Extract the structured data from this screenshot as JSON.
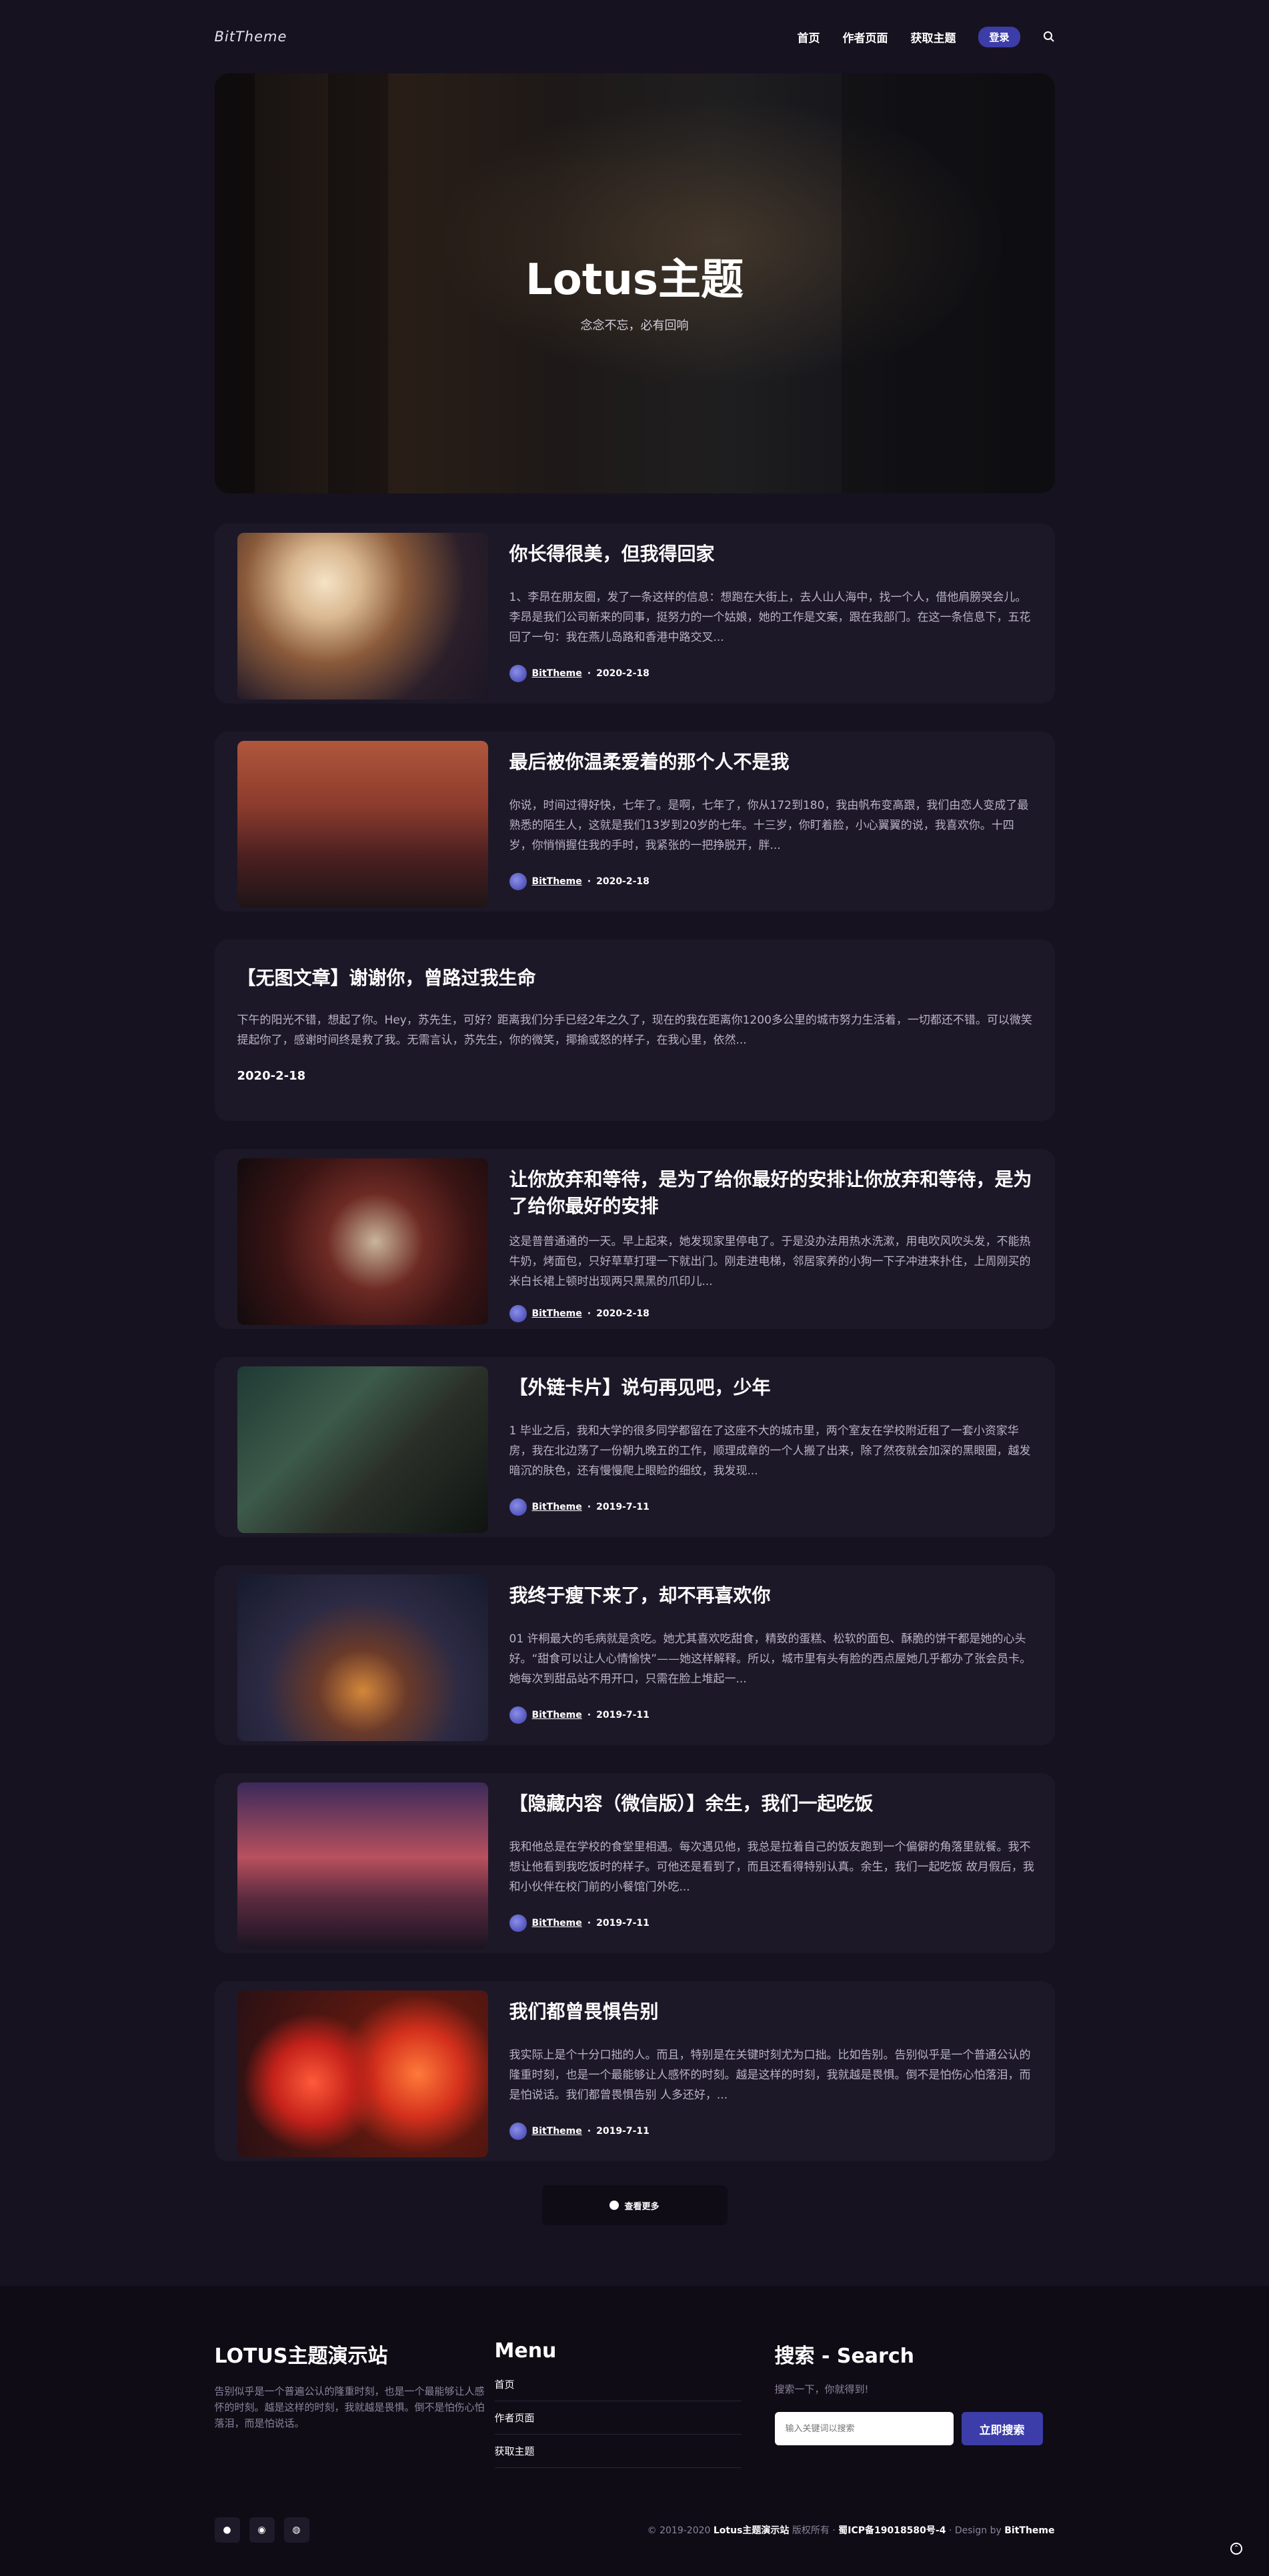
{
  "header": {
    "logo": "BitTheme",
    "nav": [
      "首页",
      "作者页面",
      "获取主题"
    ],
    "login": "登录",
    "search_icon": "search-icon"
  },
  "hero": {
    "title": "Lotus主题",
    "subtitle": "念念不忘，必有回响"
  },
  "posts": [
    {
      "title": "你长得很美，但我得回家",
      "excerpt": "1、李昂在朋友圈，发了一条这样的信息：想跑在大街上，去人山人海中，找一个人，借他肩膀哭会儿。李昂是我们公司新来的同事，挺努力的一个姑娘，她的工作是文案，跟在我部门。在这一条信息下，五花回了一句：我在燕儿岛路和香港中路交叉...",
      "author": "BitTheme",
      "date": "2020-2-18"
    },
    {
      "title": "最后被你温柔爱着的那个人不是我",
      "excerpt": "你说，时间过得好快，七年了。是啊，七年了，你从172到180，我由帆布变高跟，我们由恋人变成了最熟悉的陌生人，这就是我们13岁到20岁的七年。十三岁，你盯着脸，小心翼翼的说，我喜欢你。十四岁，你悄悄握住我的手时，我紧张的一把挣脱开，胖...",
      "author": "BitTheme",
      "date": "2020-2-18"
    },
    {
      "title": "【无图文章】谢谢你，曾路过我生命",
      "excerpt": "下午的阳光不错，想起了你。Hey，苏先生，可好？距离我们分手已经2年之久了，现在的我在距离你1200多公里的城市努力生活着，一切都还不错。可以微笑提起你了，感谢时间终是救了我。无需言认，苏先生，你的微笑，揶揄或怒的样子，在我心里，依然...",
      "date": "2020-2-18"
    },
    {
      "title": "让你放弃和等待，是为了给你最好的安排让你放弃和等待，是为了给你最好的安排",
      "excerpt": "这是普普通通的一天。早上起来，她发现家里停电了。于是没办法用热水洗漱，用电吹风吹头发，不能热牛奶，烤面包，只好草草打理一下就出门。刚走进电梯，邻居家养的小狗一下子冲进来扑住，上周刚买的米白长裙上顿时出现两只黑黑的爪印儿...",
      "author": "BitTheme",
      "date": "2020-2-18"
    },
    {
      "title": "【外链卡片】说句再见吧，少年",
      "excerpt": "1 毕业之后，我和大学的很多同学都留在了这座不大的城市里，两个室友在学校附近租了一套小资家华房，我在北边荡了一份朝九晚五的工作，顺理成章的一个人搬了出来，除了然夜就会加深的黑眼圈，越发暗沉的肤色，还有慢慢爬上眼睑的细纹，我发现...",
      "author": "BitTheme",
      "date": "2019-7-11"
    },
    {
      "title": "我终于瘦下来了，却不再喜欢你",
      "excerpt": "01 许桐最大的毛病就是贪吃。她尤其喜欢吃甜食，精致的蛋糕、松软的面包、酥脆的饼干都是她的心头好。“甜食可以让人心情愉快”——她这样解释。所以，城市里有头有脸的西点屋她几乎都办了张会员卡。她每次到甜品站不用开口，只需在脸上堆起一...",
      "author": "BitTheme",
      "date": "2019-7-11"
    },
    {
      "title": "【隐藏内容（微信版）】余生，我们一起吃饭",
      "excerpt": "我和他总是在学校的食堂里相遇。每次遇见他，我总是拉着自己的饭友跑到一个偏僻的角落里就餐。我不想让他看到我吃饭时的样子。可他还是看到了，而且还看得特别认真。余生，我们一起吃饭 故月假后，我和小伙伴在校门前的小餐馆门外吃...",
      "author": "BitTheme",
      "date": "2019-7-11"
    },
    {
      "title": "我们都曾畏惧告别",
      "excerpt": "我实际上是个十分口拙的人。而且，特别是在关键时刻尤为口拙。比如告别。告别似乎是一个普通公认的隆重时刻，也是一个最能够让人感怀的时刻。越是这样的时刻，我就越是畏惧。倒不是怕伤心怕落泪，而是怕说话。我们都曾畏惧告别 人多还好，...",
      "author": "BitTheme",
      "date": "2019-7-11"
    }
  ],
  "load_more": "查看更多",
  "footer": {
    "site_title": "LOTUS主题演示站",
    "site_desc": "告别似乎是一个普遍公认的隆重时刻，也是一个最能够让人感怀的时刻。越是这样的时刻，我就越是畏惧。倒不是怕伤心怕落泪，而是怕说话。",
    "menu_title": "Menu",
    "menu": [
      "首页",
      "作者页面",
      "获取主题"
    ],
    "search_title": "搜索 - Search",
    "search_sub": "搜索一下，你就得到!",
    "search_placeholder": "输入关键词以搜索",
    "search_button": "立即搜索",
    "copyright_prefix": "© 2019-2020",
    "copyright_site": "Lotus主题演示站",
    "copyright_rights": "版权所有 ·",
    "icp": "蜀ICP备19018580号-4",
    "design_by_label": "· Design by",
    "designer": "BitTheme"
  }
}
